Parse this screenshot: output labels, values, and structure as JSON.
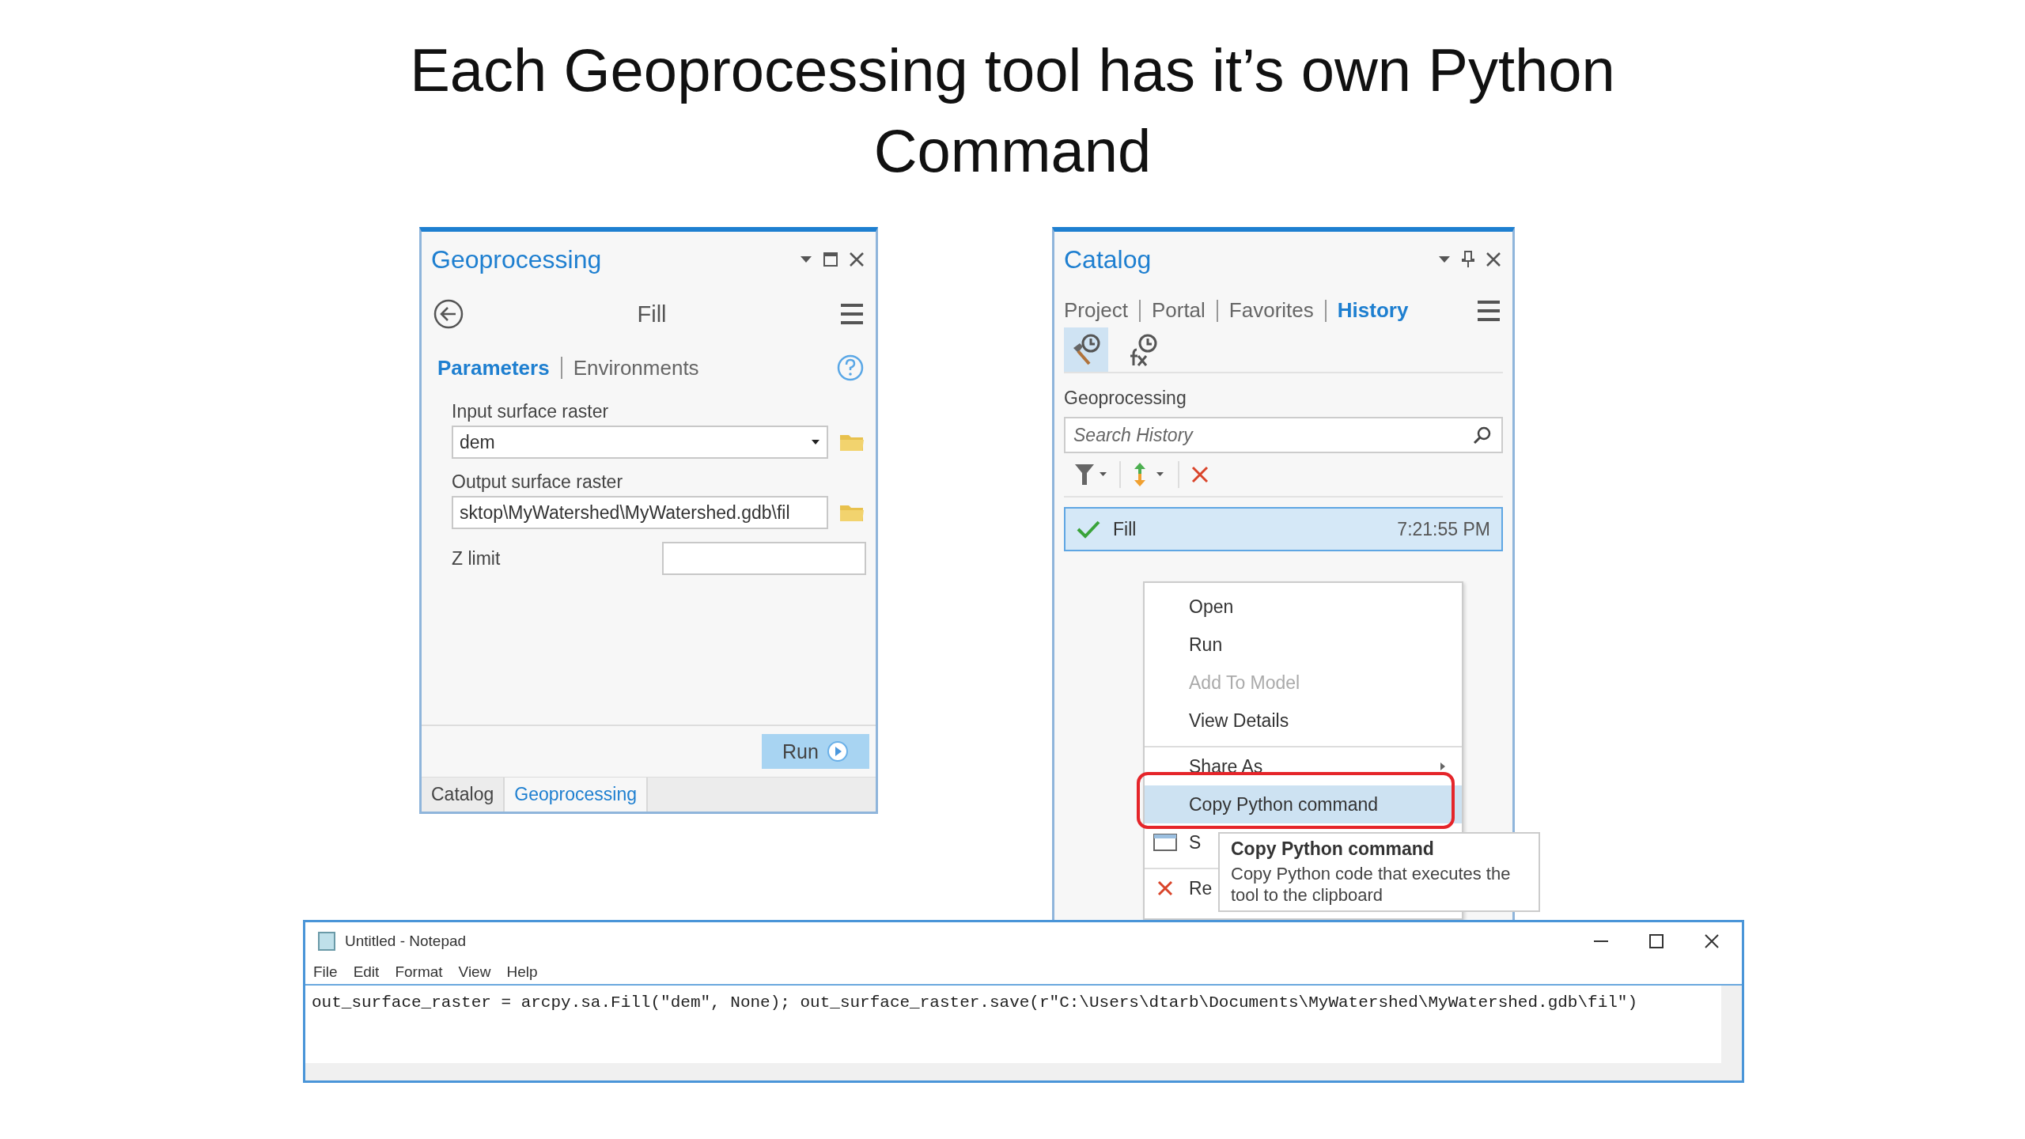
{
  "slide_title": "Each Geoprocessing tool has it’s own Python Command",
  "geoprocessing": {
    "title": "Geoprocessing",
    "tool": "Fill",
    "tabs": [
      {
        "label": "Parameters",
        "selected": true
      },
      {
        "label": "Environments",
        "selected": false
      }
    ],
    "parameters": [
      {
        "kind": "combo",
        "label": "Input surface raster",
        "value": "dem"
      },
      {
        "kind": "path",
        "label": "Output surface raster",
        "value": "sktop\\MyWatershed\\MyWatershed.gdb\\fil"
      },
      {
        "kind": "number",
        "label": "Z limit"
      }
    ],
    "run_button": "Run",
    "dock_tabs": [
      {
        "label": "Catalog",
        "selected": false
      },
      {
        "label": "Geoprocessing",
        "selected": true
      }
    ]
  },
  "catalog": {
    "title": "Catalog",
    "tabs": [
      {
        "label": "Project",
        "selected": false
      },
      {
        "label": "Portal",
        "selected": false
      },
      {
        "label": "Favorites",
        "selected": false
      },
      {
        "label": "History",
        "selected": true
      }
    ],
    "views": [
      {
        "kind": "tools",
        "selected": true
      },
      {
        "kind": "functions",
        "selected": false
      }
    ],
    "section": "Geoprocessing",
    "search": {
      "placeholder": "Search History"
    },
    "entries": [
      {
        "name": "Fill",
        "time": "7:21:55 PM",
        "succeeded": true,
        "selected": true
      }
    ],
    "context_menu": [
      {
        "kind": "item",
        "label": "Open",
        "disabled": false,
        "selected": false
      },
      {
        "kind": "item",
        "label": "Run",
        "disabled": false,
        "selected": false
      },
      {
        "kind": "item",
        "label": "Add To Model",
        "disabled": true,
        "selected": false
      },
      {
        "kind": "item",
        "label": "View Details",
        "disabled": false,
        "selected": false
      },
      {
        "kind": "submenu",
        "label": "Share As",
        "disabled": false,
        "selected": false
      },
      {
        "kind": "item",
        "label": "Copy Python command",
        "disabled": false,
        "selected": true
      },
      {
        "kind": "window",
        "label": "S",
        "disabled": false,
        "selected": false
      },
      {
        "kind": "remove",
        "label": "Re",
        "disabled": false,
        "selected": false
      }
    ],
    "tooltip": {
      "title": "Copy Python command",
      "text": "Copy Python code that executes the tool to the clipboard"
    }
  },
  "notepad": {
    "title": "Untitled - Notepad",
    "menu": [
      "File",
      "Edit",
      "Format",
      "View",
      "Help"
    ],
    "text": "out_surface_raster = arcpy.sa.Fill(\"dem\", None); out_surface_raster.save(r\"C:\\Users\\dtarb\\Documents\\MyWatershed\\MyWatershed.gdb\\fil\")"
  }
}
